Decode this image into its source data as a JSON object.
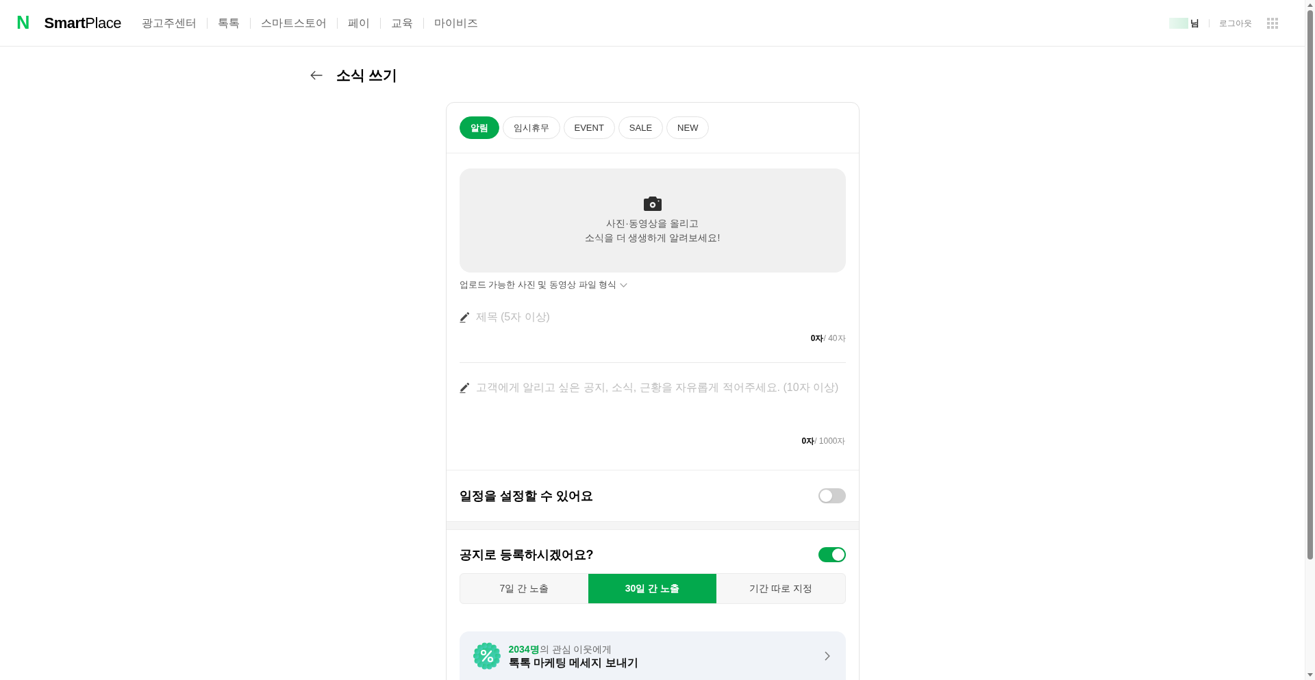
{
  "header": {
    "logo_mark": "N",
    "logo_text": "**Smart**Place",
    "nav": [
      "광고주센터",
      "톡톡",
      "스마트스토어",
      "페이",
      "교육",
      "마이비즈"
    ],
    "user_suffix": "님",
    "logout": "로그아웃"
  },
  "page": {
    "title": "소식 쓰기"
  },
  "categories": [
    {
      "label": "알림",
      "selected": true
    },
    {
      "label": "임시휴무",
      "selected": false
    },
    {
      "label": "EVENT",
      "selected": false
    },
    {
      "label": "SALE",
      "selected": false
    },
    {
      "label": "NEW",
      "selected": false
    }
  ],
  "upload": {
    "lines": [
      "사진·동영상을 올리고",
      "소식을 더 생생하게 알려보세요!"
    ],
    "formats": "업로드 가능한 사진 및 동영상 파일 형식"
  },
  "title_field": {
    "placeholder": "제목 (5자 이상)",
    "counter": "**0자**/ 40자"
  },
  "body_field": {
    "placeholder": "고객에게 알리고 싶은 공지, 소식, 근황을 자유롭게 적어주세요. (10자 이상)",
    "counter": "**0자**/ 1000자"
  },
  "schedule": {
    "label": "일정을 설정할 수 있어요",
    "on": false
  },
  "notice": {
    "label": "공지로 등록하시겠어요?",
    "on": true,
    "periods": [
      {
        "label": "7일 간 노출",
        "selected": false
      },
      {
        "label": "30일 간 노출",
        "selected": true
      },
      {
        "label": "기간 따로 지정",
        "selected": false
      }
    ]
  },
  "promo": {
    "line_1": "**2034명**의 관심 이웃에게",
    "line_2": "톡톡 마케팅 메세지 보내기"
  }
}
